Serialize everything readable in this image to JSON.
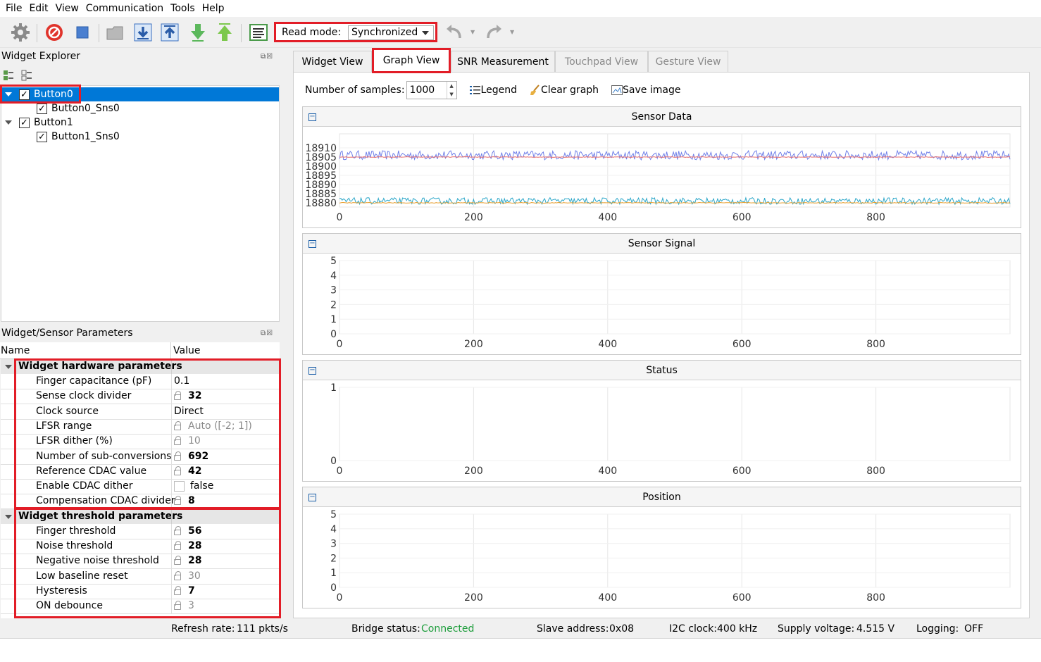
{
  "menu": [
    "File",
    "Edit",
    "View",
    "Communication",
    "Tools",
    "Help"
  ],
  "toolbar": {
    "read_mode_label": "Read mode:",
    "read_mode_value": "Synchronized",
    "icons": [
      "gear-icon",
      "stop-red-icon",
      "stop-icon",
      "open-folder-icon",
      "read-icon",
      "write-icon",
      "import-icon",
      "export-icon",
      "log-icon",
      "undo-icon",
      "redo-icon"
    ]
  },
  "widget_explorer": {
    "title": "Widget Explorer",
    "tree": [
      {
        "label": "Button0",
        "checked": true,
        "selected": true,
        "level": 0
      },
      {
        "label": "Button0_Sns0",
        "checked": true,
        "level": 1
      },
      {
        "label": "Button1",
        "checked": true,
        "level": 0
      },
      {
        "label": "Button1_Sns0",
        "checked": true,
        "level": 1
      }
    ]
  },
  "params": {
    "title": "Widget/Sensor Parameters",
    "col_name": "Name",
    "col_value": "Value",
    "groups": [
      {
        "title": "Widget hardware parameters",
        "rows": [
          {
            "name": "Finger capacitance (pF)",
            "value": "0.1",
            "locked": false,
            "bold": false,
            "disabled": false
          },
          {
            "name": "Sense clock divider",
            "value": "32",
            "locked": true,
            "bold": true,
            "disabled": false
          },
          {
            "name": "Clock source",
            "value": "Direct",
            "locked": false,
            "bold": false,
            "disabled": false
          },
          {
            "name": "LFSR range",
            "value": "Auto ([-2; 1])",
            "locked": true,
            "bold": false,
            "disabled": true
          },
          {
            "name": "LFSR dither (%)",
            "value": "10",
            "locked": true,
            "bold": false,
            "disabled": true
          },
          {
            "name": "Number of sub-conversions",
            "value": "692",
            "locked": true,
            "bold": true,
            "disabled": false
          },
          {
            "name": "Reference CDAC value",
            "value": "42",
            "locked": true,
            "bold": true,
            "disabled": false
          },
          {
            "name": "Enable CDAC dither",
            "value": "false",
            "locked": false,
            "checkbox": true,
            "bold": false,
            "disabled": false
          },
          {
            "name": "Compensation CDAC divider",
            "value": "8",
            "locked": true,
            "bold": true,
            "disabled": false
          }
        ]
      },
      {
        "title": "Widget threshold parameters",
        "rows": [
          {
            "name": "Finger threshold",
            "value": "56",
            "locked": true,
            "bold": true,
            "disabled": false
          },
          {
            "name": "Noise threshold",
            "value": "28",
            "locked": true,
            "bold": true,
            "disabled": false
          },
          {
            "name": "Negative noise threshold",
            "value": "28",
            "locked": true,
            "bold": true,
            "disabled": false
          },
          {
            "name": "Low baseline reset",
            "value": "30",
            "locked": true,
            "bold": false,
            "disabled": true
          },
          {
            "name": "Hysteresis",
            "value": "7",
            "locked": true,
            "bold": true,
            "disabled": false
          },
          {
            "name": "ON debounce",
            "value": "3",
            "locked": true,
            "bold": false,
            "disabled": true
          }
        ]
      }
    ]
  },
  "tabs": [
    {
      "label": "Widget View",
      "active": false,
      "disabled": false
    },
    {
      "label": "Graph View",
      "active": true,
      "disabled": false
    },
    {
      "label": "SNR Measurement",
      "active": false,
      "disabled": false
    },
    {
      "label": "Touchpad View",
      "active": false,
      "disabled": true
    },
    {
      "label": "Gesture View",
      "active": false,
      "disabled": true
    }
  ],
  "graph": {
    "samples_label": "Number of samples:",
    "samples_value": "1000",
    "legend_label": "Legend",
    "clear_label": "Clear graph",
    "save_label": "Save image"
  },
  "chart_data": [
    {
      "type": "line",
      "title": "Sensor Data",
      "x_ticks": [
        "0",
        "200",
        "400",
        "600",
        "800"
      ],
      "y_ticks": [
        "18910",
        "18905",
        "18900",
        "18895",
        "18890",
        "18885",
        "18880"
      ],
      "xlim": [
        0,
        1000
      ],
      "ylim": [
        18878,
        18912
      ],
      "series": [
        {
          "color": "#6f7fe8",
          "values_mean": 18906,
          "noise": 2.5
        },
        {
          "color": "#e86f6f",
          "values_mean": 18905,
          "noise": 0.2
        },
        {
          "color": "#2aa6c8",
          "values_mean": 18881,
          "noise": 1.8
        },
        {
          "color": "#e8a030",
          "values_mean": 18880,
          "noise": 0.2
        }
      ]
    },
    {
      "type": "line",
      "title": "Sensor Signal",
      "x_ticks": [
        "0",
        "200",
        "400",
        "600",
        "800"
      ],
      "y_ticks": [
        "5",
        "4",
        "3",
        "2",
        "1",
        "0"
      ],
      "xlim": [
        0,
        1000
      ],
      "ylim": [
        0,
        5
      ]
    },
    {
      "type": "line",
      "title": "Status",
      "x_ticks": [
        "0",
        "200",
        "400",
        "600",
        "800"
      ],
      "y_ticks": [
        "1",
        "0"
      ],
      "xlim": [
        0,
        1000
      ],
      "ylim": [
        0,
        1
      ]
    },
    {
      "type": "line",
      "title": "Position",
      "x_ticks": [
        "0",
        "200",
        "400",
        "600",
        "800"
      ],
      "y_ticks": [
        "5",
        "4",
        "3",
        "2",
        "1",
        "0"
      ],
      "xlim": [
        0,
        1000
      ],
      "ylim": [
        0,
        5
      ]
    }
  ],
  "status": {
    "refresh_label": "Refresh rate:",
    "refresh_value": "111 pkts/s",
    "bridge_label": "Bridge status:",
    "bridge_value": "Connected",
    "slave_label": "Slave address:",
    "slave_value": "0x08",
    "i2c_label": "I2C clock:",
    "i2c_value": "400 kHz",
    "supply_label": "Supply voltage:",
    "supply_value": "4.515 V",
    "logging_label": "Logging:",
    "logging_value": "OFF",
    "connected_color": "#1e9e3c"
  }
}
